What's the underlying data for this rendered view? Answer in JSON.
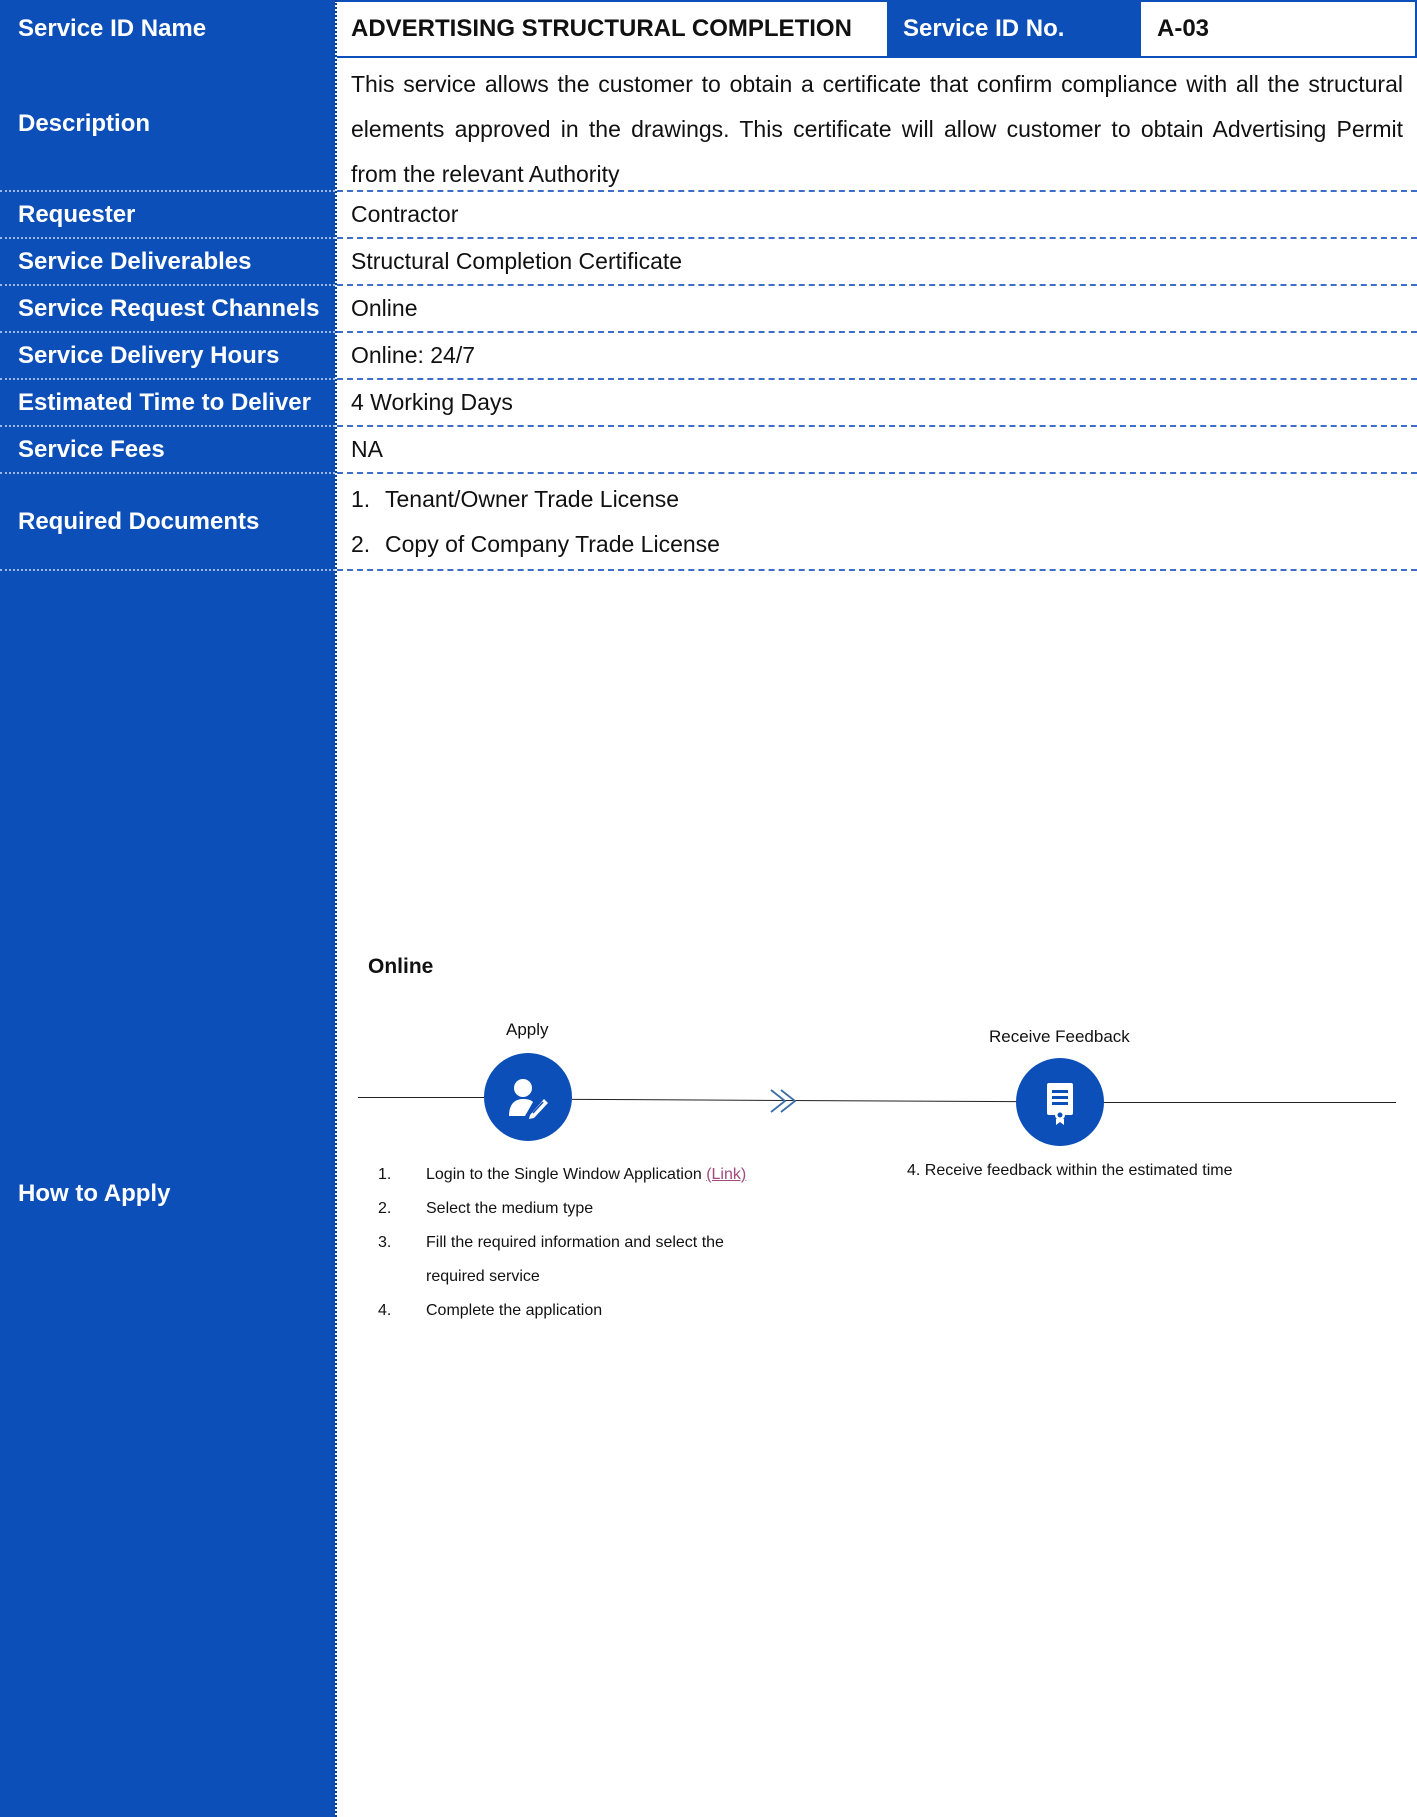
{
  "header": {
    "name_label": "Service ID Name",
    "name_value": "ADVERTISING STRUCTURAL COMPLETION",
    "no_label": "Service ID No.",
    "no_value": "A-03"
  },
  "rows": {
    "description": {
      "label": "Description",
      "value": "This service allows the customer to obtain a certificate that confirm compliance with all the structural elements approved in the drawings. This certificate will allow customer to obtain Advertising Permit from the relevant Authority"
    },
    "requester": {
      "label": "Requester",
      "value": "Contractor"
    },
    "deliverables": {
      "label": "Service Deliverables",
      "value": "Structural Completion Certificate"
    },
    "channels": {
      "label": "Service Request Channels",
      "value": "Online"
    },
    "hours": {
      "label": "Service Delivery Hours",
      "value": "Online: 24/7"
    },
    "time": {
      "label": "Estimated Time to Deliver",
      "value": "4 Working Days"
    },
    "fees": {
      "label": "Service Fees",
      "value": "NA"
    },
    "documents": {
      "label": "Required Documents",
      "items": [
        {
          "num": "1.",
          "text": "Tenant/Owner Trade License"
        },
        {
          "num": "2.",
          "text": "Copy of Company Trade License"
        }
      ]
    },
    "how": {
      "label": "How to Apply"
    }
  },
  "flow": {
    "title": "Online",
    "step1_title": "Apply",
    "step2_title": "Receive Feedback",
    "icons": {
      "step1": "user-edit-icon",
      "step2": "certificate-icon",
      "arrow": "chevron-right-icon"
    },
    "steps": [
      {
        "num": "1.",
        "text": "Login to the Single Window Application",
        "link": "(Link)"
      },
      {
        "num": "2.",
        "text": "Select the medium type"
      },
      {
        "num": "3.",
        "text": "Fill the required information and select the required service"
      },
      {
        "num": "4.",
        "text": "Complete the application"
      }
    ],
    "step2_item": "4.  Receive feedback within the estimated time"
  },
  "colors": {
    "brand_blue": "#0d4fb8",
    "link": "#a24a7e"
  }
}
